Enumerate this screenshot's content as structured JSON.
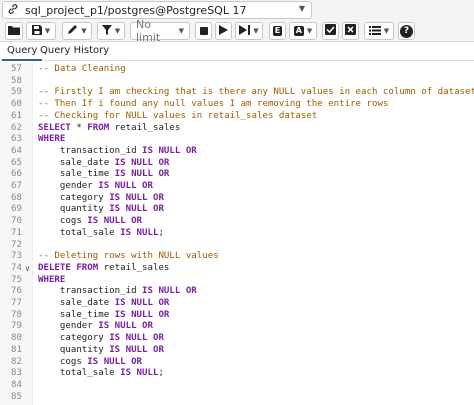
{
  "connection": {
    "label": "sql_project_p1/postgres@PostgreSQL 17"
  },
  "toolbar": {
    "limit_placeholder": "No limit",
    "icons": [
      "folder-icon",
      "save-icon",
      "pen-icon",
      "filter-icon",
      "stop-icon",
      "play-icon",
      "play-step-icon",
      "explain-icon",
      "explain-analyze-icon",
      "commit-icon",
      "rollback-icon",
      "macros-icon",
      "help-icon"
    ]
  },
  "tabs": [
    {
      "label": "Query"
    },
    {
      "label": "Query History"
    }
  ],
  "editor": {
    "lines": [
      {
        "num": "57",
        "fold": "",
        "tokens": [
          {
            "t": "-- Data Cleaning",
            "c": "comment"
          }
        ]
      },
      {
        "num": "58",
        "fold": "",
        "tokens": []
      },
      {
        "num": "59",
        "fold": "",
        "tokens": [
          {
            "t": "-- Firstly I am checking that is there any NULL values in each column of dataset.",
            "c": "comment"
          }
        ]
      },
      {
        "num": "60",
        "fold": "",
        "tokens": [
          {
            "t": "-- Then If i found any null values I am removing the entire rows",
            "c": "comment"
          }
        ]
      },
      {
        "num": "61",
        "fold": "",
        "tokens": [
          {
            "t": "-- Checking for NULL values in retail_sales dataset",
            "c": "comment"
          }
        ]
      },
      {
        "num": "62",
        "fold": "",
        "tokens": [
          {
            "t": "SELECT",
            "c": "kw"
          },
          {
            "t": " * ",
            "c": "txt"
          },
          {
            "t": "FROM",
            "c": "kw"
          },
          {
            "t": " retail_sales",
            "c": "txt"
          }
        ]
      },
      {
        "num": "63",
        "fold": "",
        "tokens": [
          {
            "t": "WHERE",
            "c": "kw"
          }
        ]
      },
      {
        "num": "64",
        "fold": "",
        "tokens": [
          {
            "t": "    transaction_id ",
            "c": "txt"
          },
          {
            "t": "IS NULL OR",
            "c": "kw"
          }
        ]
      },
      {
        "num": "65",
        "fold": "",
        "tokens": [
          {
            "t": "    sale_date ",
            "c": "txt"
          },
          {
            "t": "IS NULL OR",
            "c": "kw"
          }
        ]
      },
      {
        "num": "66",
        "fold": "",
        "tokens": [
          {
            "t": "    sale_time ",
            "c": "txt"
          },
          {
            "t": "IS NULL OR",
            "c": "kw"
          }
        ]
      },
      {
        "num": "67",
        "fold": "",
        "tokens": [
          {
            "t": "    gender ",
            "c": "txt"
          },
          {
            "t": "IS NULL OR",
            "c": "kw"
          }
        ]
      },
      {
        "num": "68",
        "fold": "",
        "tokens": [
          {
            "t": "    category ",
            "c": "txt"
          },
          {
            "t": "IS NULL OR",
            "c": "kw"
          }
        ]
      },
      {
        "num": "69",
        "fold": "",
        "tokens": [
          {
            "t": "    quantity ",
            "c": "txt"
          },
          {
            "t": "IS NULL OR",
            "c": "kw"
          }
        ]
      },
      {
        "num": "70",
        "fold": "",
        "tokens": [
          {
            "t": "    cogs ",
            "c": "txt"
          },
          {
            "t": "IS NULL OR",
            "c": "kw"
          }
        ]
      },
      {
        "num": "71",
        "fold": "",
        "tokens": [
          {
            "t": "    total_sale ",
            "c": "txt"
          },
          {
            "t": "IS NULL",
            "c": "kw"
          },
          {
            "t": ";",
            "c": "txt"
          }
        ]
      },
      {
        "num": "72",
        "fold": "",
        "tokens": []
      },
      {
        "num": "73",
        "fold": "",
        "tokens": [
          {
            "t": "-- Deleting rows with NULL values",
            "c": "comment"
          }
        ]
      },
      {
        "num": "74",
        "fold": "v",
        "tokens": [
          {
            "t": "DELETE FROM",
            "c": "kw"
          },
          {
            "t": " retail_sales",
            "c": "txt"
          }
        ]
      },
      {
        "num": "75",
        "fold": "",
        "tokens": [
          {
            "t": "WHERE",
            "c": "kw"
          }
        ]
      },
      {
        "num": "76",
        "fold": "",
        "tokens": [
          {
            "t": "    transaction_id ",
            "c": "txt"
          },
          {
            "t": "IS NULL OR",
            "c": "kw"
          }
        ]
      },
      {
        "num": "77",
        "fold": "",
        "tokens": [
          {
            "t": "    sale_date ",
            "c": "txt"
          },
          {
            "t": "IS NULL OR",
            "c": "kw"
          }
        ]
      },
      {
        "num": "78",
        "fold": "",
        "tokens": [
          {
            "t": "    sale_time ",
            "c": "txt"
          },
          {
            "t": "IS NULL OR",
            "c": "kw"
          }
        ]
      },
      {
        "num": "79",
        "fold": "",
        "tokens": [
          {
            "t": "    gender ",
            "c": "txt"
          },
          {
            "t": "IS NULL OR",
            "c": "kw"
          }
        ]
      },
      {
        "num": "80",
        "fold": "",
        "tokens": [
          {
            "t": "    category ",
            "c": "txt"
          },
          {
            "t": "IS NULL OR",
            "c": "kw"
          }
        ]
      },
      {
        "num": "81",
        "fold": "",
        "tokens": [
          {
            "t": "    quantity ",
            "c": "txt"
          },
          {
            "t": "IS NULL OR",
            "c": "kw"
          }
        ]
      },
      {
        "num": "82",
        "fold": "",
        "tokens": [
          {
            "t": "    cogs ",
            "c": "txt"
          },
          {
            "t": "IS NULL OR",
            "c": "kw"
          }
        ]
      },
      {
        "num": "83",
        "fold": "",
        "tokens": [
          {
            "t": "    total_sale ",
            "c": "txt"
          },
          {
            "t": "IS NULL",
            "c": "kw"
          },
          {
            "t": ";",
            "c": "txt"
          }
        ]
      },
      {
        "num": "84",
        "fold": "",
        "tokens": []
      },
      {
        "num": "85",
        "fold": "",
        "tokens": []
      }
    ]
  },
  "colors": {
    "comment": "#a05a00",
    "keyword": "#7a1fa2",
    "tab_accent": "#326690"
  }
}
